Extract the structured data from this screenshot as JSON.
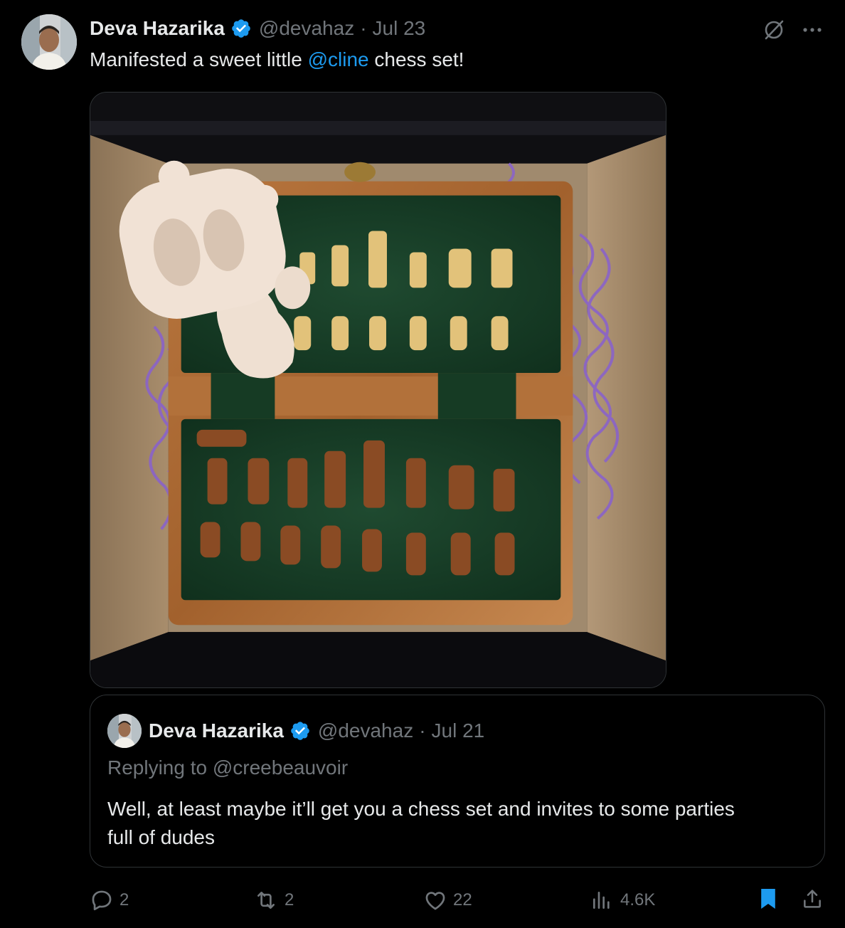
{
  "tweet": {
    "author_name": "Deva Hazarika",
    "handle": "@devahaz",
    "separator": "·",
    "date": "Jul 23",
    "text_before": "Manifested a sweet little ",
    "mention": "@cline",
    "text_after": " chess set!",
    "image_alt": "Cline robot figurine next to a wooden magnetic chess set in a gift box"
  },
  "quoted": {
    "author_name": "Deva Hazarika",
    "handle": "@devahaz",
    "separator": "·",
    "date": "Jul 21",
    "replying_to": "Replying to @creebeauvoir",
    "text_line1": "Well, at least maybe it’ll get you a chess set and invites to some parties",
    "text_line2": "full of dudes"
  },
  "actions": {
    "replies": "2",
    "reposts": "2",
    "likes": "22",
    "views": "4.6K"
  },
  "colors": {
    "background": "#000000",
    "text": "#e7e9ea",
    "muted": "#71767b",
    "accent": "#1d9bf0",
    "border": "#2f3336",
    "bookmark_active": "#1d9bf0"
  },
  "icons": [
    "grok-icon",
    "more-icon",
    "verified-icon",
    "reply-icon",
    "repost-icon",
    "like-icon",
    "views-icon",
    "bookmark-icon",
    "share-icon"
  ]
}
